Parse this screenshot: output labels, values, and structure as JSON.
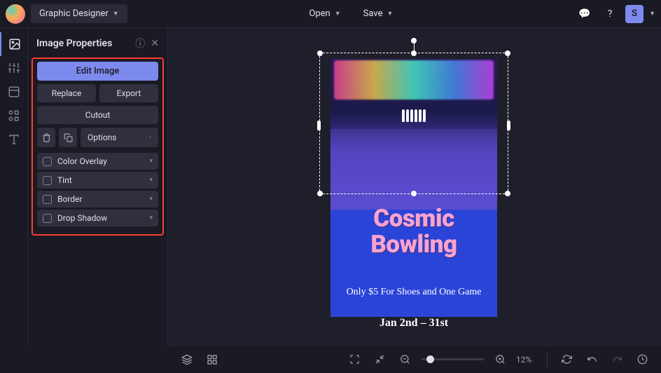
{
  "topbar": {
    "workspace_label": "Graphic Designer",
    "open_label": "Open",
    "save_label": "Save",
    "avatar_initial": "S"
  },
  "panel": {
    "title": "Image Properties",
    "edit_image": "Edit Image",
    "replace": "Replace",
    "export": "Export",
    "cutout": "Cutout",
    "options": "Options",
    "props": {
      "color_overlay": "Color Overlay",
      "tint": "Tint",
      "border": "Border",
      "drop_shadow": "Drop Shadow"
    }
  },
  "poster": {
    "title_line1": "Cosmic",
    "title_line2": "Bowling",
    "subtitle": "Only $5 For Shoes and One Game",
    "date": "Jan 2nd – 31st"
  },
  "bottombar": {
    "zoom": "12%"
  }
}
